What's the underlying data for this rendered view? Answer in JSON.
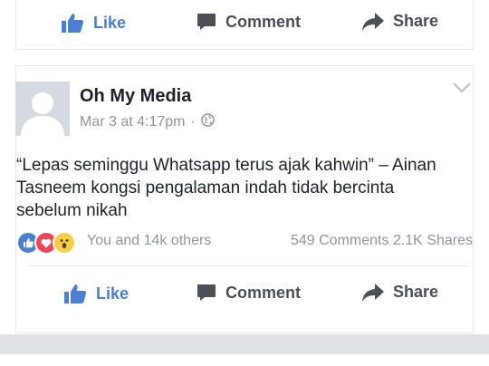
{
  "top_actions": {
    "like": "Like",
    "comment": "Comment",
    "share": "Share"
  },
  "post": {
    "page_name": "Oh My Media",
    "date": "Mar 3 at 4:17pm",
    "separator": "·",
    "text": "“Lepas seminggu Whatsapp terus ajak kahwin” – Ainan Tasneem kongsi pengalaman indah tidak bercinta sebelum nikah",
    "reactions_text": "You and 14k others",
    "comments": "549 Comments",
    "shares": "2.1K Shares",
    "actions": {
      "like": "Like",
      "comment": "Comment",
      "share": "Share"
    }
  },
  "colors": {
    "like_blue": "#4a7fd1",
    "text_gray": "#90949c",
    "love_red": "#f0445a",
    "wow_yellow": "#f7cf45"
  },
  "icons": [
    "like-icon",
    "comment-icon",
    "share-icon",
    "globe-icon",
    "chevron-down-icon",
    "reaction-like-icon",
    "reaction-love-icon",
    "reaction-wow-icon"
  ]
}
